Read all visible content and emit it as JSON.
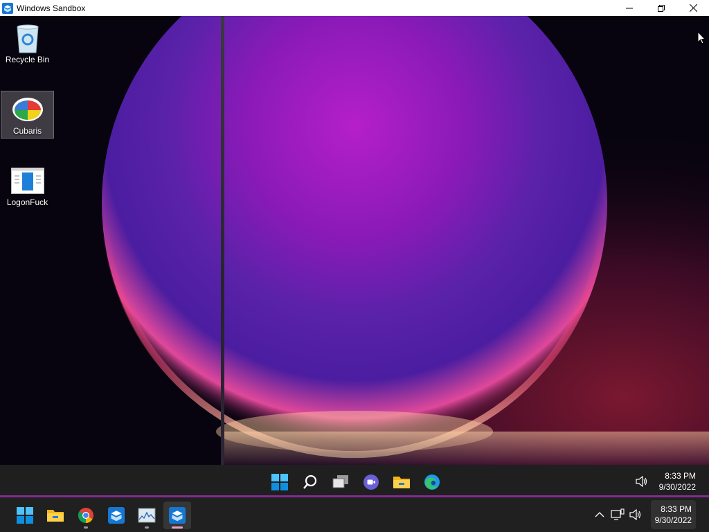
{
  "window": {
    "title": "Windows Sandbox",
    "icon": "sandbox-icon",
    "controls": [
      "minimize-icon",
      "restore-icon",
      "close-icon"
    ]
  },
  "desktop": {
    "icons": [
      {
        "label": "Recycle Bin",
        "icon": "recycle-bin-icon"
      },
      {
        "label": "Cubaris",
        "icon": "cubaris-app-icon",
        "selected": true
      },
      {
        "label": "LogonFuck",
        "icon": "logonfuck-app-icon"
      }
    ]
  },
  "inner_taskbar": {
    "apps": [
      "windows-start-icon",
      "search-icon",
      "task-view-icon",
      "chat-icon",
      "file-explorer-icon",
      "edge-icon"
    ],
    "tray": [
      "volume-icon"
    ],
    "time": "8:33 PM",
    "date": "9/30/2022"
  },
  "host_taskbar": {
    "apps": [
      {
        "icon": "windows-start-icon",
        "running": false
      },
      {
        "icon": "file-explorer-icon",
        "running": false
      },
      {
        "icon": "chrome-icon",
        "running": true
      },
      {
        "icon": "sandbox-icon",
        "running": false
      },
      {
        "icon": "resource-monitor-icon",
        "running": true
      },
      {
        "icon": "sandbox-icon",
        "running": true,
        "active": true
      }
    ],
    "tray": [
      "chevron-up-icon",
      "network-icon",
      "volume-icon"
    ],
    "time": "8:33 PM",
    "date": "9/30/2022"
  },
  "colors": {
    "accent": "#0078d4",
    "taskbar": "#202020",
    "active_indicator": "#e5a2c9"
  }
}
